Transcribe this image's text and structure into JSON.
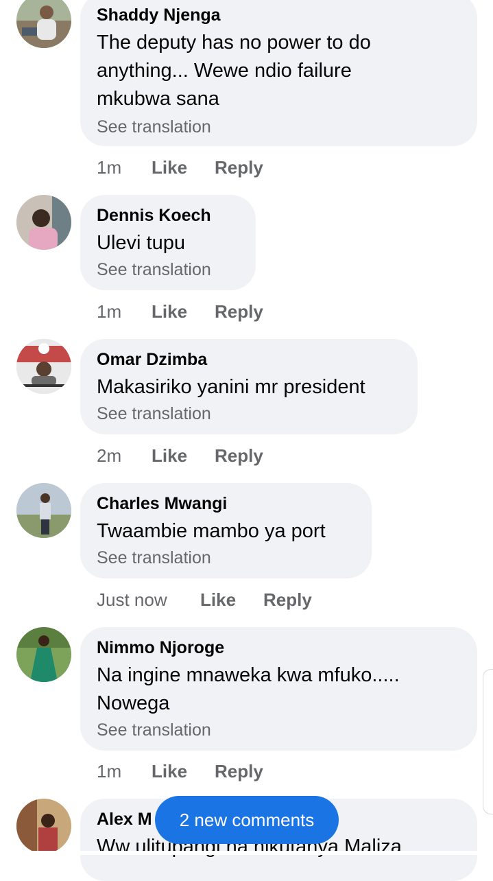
{
  "comments": [
    {
      "author": "Shaddy Njenga",
      "lines": [
        "The deputy has no power to do",
        "anything... Wewe ndio failure",
        "mkubwa sana"
      ],
      "see_translation": "See translation",
      "time": "1m",
      "like": "Like",
      "reply": "Reply",
      "avatar_icon": "profile-photo"
    },
    {
      "author": "Dennis Koech",
      "lines": [
        "Ulevi tupu"
      ],
      "see_translation": "See translation",
      "time": "1m",
      "like": "Like",
      "reply": "Reply",
      "avatar_icon": "profile-photo"
    },
    {
      "author": "Omar Dzimba",
      "lines": [
        "Makasiriko yanini mr president"
      ],
      "see_translation": "See translation",
      "time": "2m",
      "like": "Like",
      "reply": "Reply",
      "avatar_icon": "profile-photo"
    },
    {
      "author": "Charles Mwangi",
      "lines": [
        "Twaambie mambo ya port"
      ],
      "see_translation": "See translation",
      "time": "Just now",
      "like": "Like",
      "reply": "Reply",
      "avatar_icon": "profile-photo"
    },
    {
      "author": "Nimmo Njoroge",
      "lines": [
        "Na ingine mnaweka kwa mfuko.....",
        "Nowega"
      ],
      "see_translation": "See translation",
      "time": "1m",
      "like": "Like",
      "reply": "Reply",
      "avatar_icon": "profile-photo"
    },
    {
      "author": "Alex M",
      "lines": [
        "Ww ulitupangi na nikutanya Maliza"
      ],
      "avatar_icon": "profile-photo"
    }
  ],
  "new_comments_pill": "2 new comments",
  "colors": {
    "bubble": "#f0f2f5",
    "meta_text": "#65676b",
    "pill": "#1b74e4"
  }
}
